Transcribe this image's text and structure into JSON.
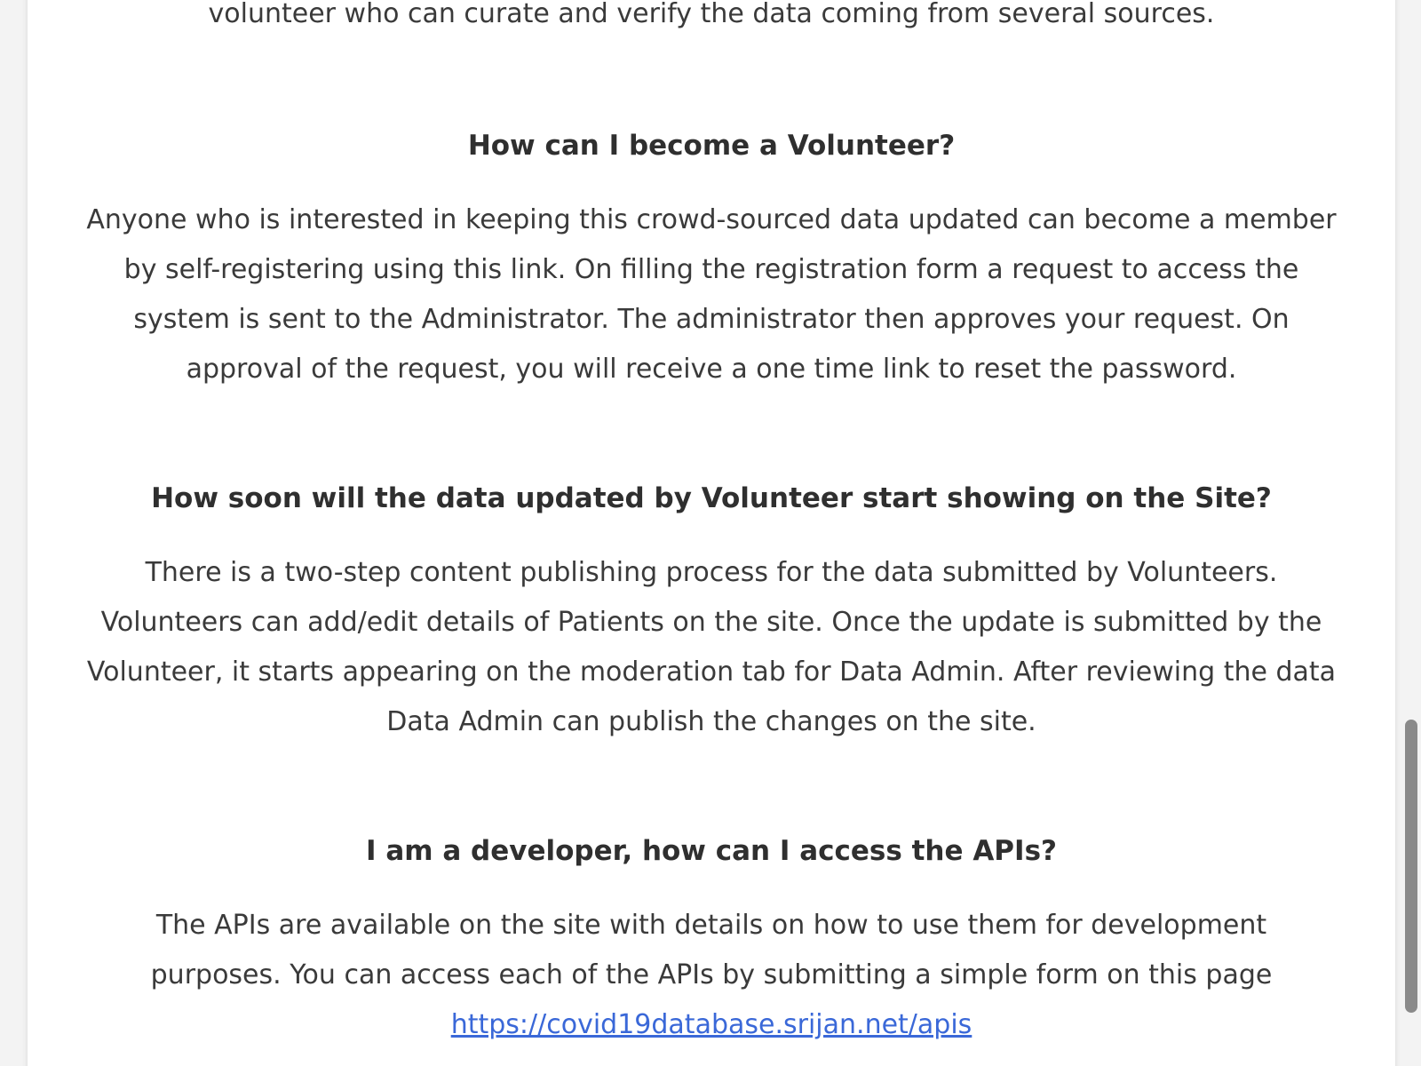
{
  "intro": {
    "text": "The COVID Patient database is based on crowdsourced data. We encourage people to volunteer who can curate and verify the data coming from several sources."
  },
  "faqs": [
    {
      "question": "How can I become a Volunteer?",
      "answer": "Anyone who is interested in keeping this crowd-sourced data updated can become a member by self-registering using this link. On filling the registration form a request to access the system is sent to the Administrator. The administrator then approves your request. On approval of the request, you will receive a one time link to reset the password."
    },
    {
      "question": "How soon will the data updated by Volunteer start showing on the Site?",
      "answer": "There is a two-step content publishing process for the data submitted by Volunteers. Volunteers can add/edit details of Patients on the site. Once the update is submitted by the Volunteer, it starts appearing on the moderation tab for Data Admin. After reviewing the data Data Admin can publish the changes on the site."
    },
    {
      "question": "I am a developer, how can I access the APIs?",
      "answer": "The APIs are available on the site with details on how to use them for development purposes. You can access each of the APIs by submitting a simple form on this page",
      "link_text": "https://covid19database.srijan.net/apis"
    }
  ],
  "colors": {
    "link": "#3a68d8",
    "text": "#333333",
    "background": "#ffffff"
  },
  "scroll_position": 0.66
}
